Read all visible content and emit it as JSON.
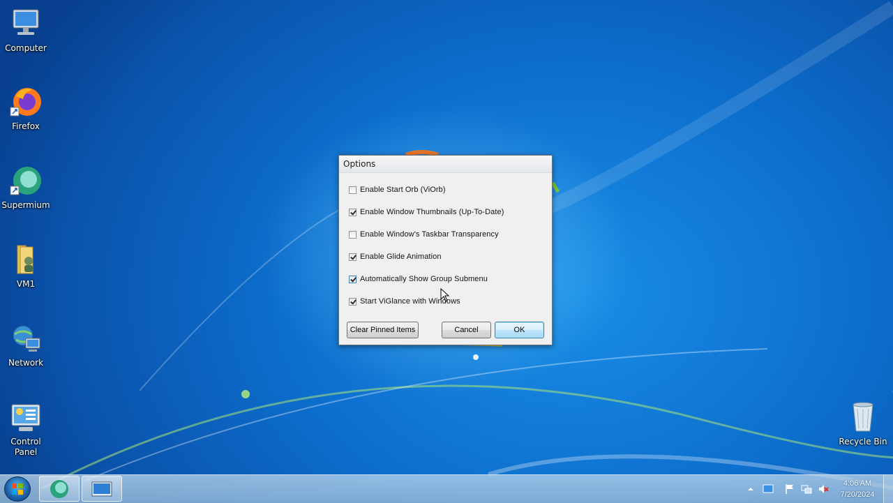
{
  "desktop": {
    "icons": [
      {
        "label": "Computer",
        "icon": "computer-icon"
      },
      {
        "label": "Firefox",
        "icon": "firefox-icon"
      },
      {
        "label": "Supermium",
        "icon": "supermium-icon"
      },
      {
        "label": "VM1",
        "icon": "folder-icon"
      },
      {
        "label": "Network",
        "icon": "network-icon"
      },
      {
        "label": "Control Panel",
        "icon": "control-panel-icon"
      },
      {
        "label": "Recycle Bin",
        "icon": "recycle-bin-icon"
      }
    ]
  },
  "dialog": {
    "title": "Options",
    "options": [
      {
        "label": "Enable Start Orb (ViOrb)",
        "checked": false
      },
      {
        "label": "Enable Window Thumbnails (Up-To-Date)",
        "checked": true
      },
      {
        "label": "Enable Window's Taskbar Transparency",
        "checked": false
      },
      {
        "label": "Enable Glide Animation",
        "checked": true
      },
      {
        "label": "Automatically Show Group Submenu",
        "checked": true
      },
      {
        "label": "Start ViGlance with Windows",
        "checked": true
      }
    ],
    "buttons": {
      "clear": "Clear Pinned Items",
      "cancel": "Cancel",
      "ok": "OK"
    }
  },
  "taskbar": {
    "time": "4:06 AM",
    "date": "7/20/2024",
    "pinned": [
      "supermium-icon",
      "desktop-window-icon"
    ]
  },
  "colors": {
    "desktop_blue": "#0d6fce",
    "accent_border": "#3c7fb1"
  }
}
